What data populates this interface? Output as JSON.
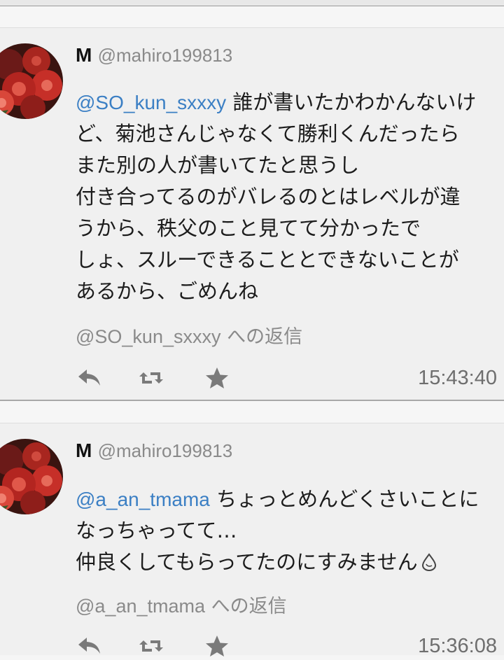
{
  "tweets": [
    {
      "display_name": "M",
      "handle": "@mahiro199813",
      "text_lines": [
        {
          "mention": "@SO_kun_sxxxy",
          "text": " 誰が書いたかわかんないけ"
        },
        {
          "mention": "",
          "text": "ど、菊池さんじゃなくて勝利くんだったら"
        },
        {
          "mention": "",
          "text": "また別の人が書いてたと思うし"
        },
        {
          "mention": "",
          "text": "付き合ってるのがバレるのとはレベルが違"
        },
        {
          "mention": "",
          "text": "うから、秩父のこと見てて分かったで"
        },
        {
          "mention": "",
          "text": "しょ、スルーできることとできないことが"
        },
        {
          "mention": "",
          "text": "あるから、ごめんね"
        }
      ],
      "reply_to_handle": "@SO_kun_sxxxy",
      "reply_to_suffix": " への返信",
      "time": "15:43:40",
      "icons": {
        "reply": "reply-icon",
        "retweet": "retweet-icon",
        "favorite": "star-icon"
      }
    },
    {
      "display_name": "M",
      "handle": "@mahiro199813",
      "text_lines": [
        {
          "mention": "@a_an_tmama",
          "text": " ちょっとめんどくさいことに"
        },
        {
          "mention": "",
          "text": "なっちゃってて…"
        },
        {
          "mention": "",
          "text": "仲良くしてもらってたのにすみません"
        }
      ],
      "reply_to_handle": "@a_an_tmama",
      "reply_to_suffix": " への返信",
      "time": "15:36:08",
      "icons": {
        "reply": "reply-icon",
        "retweet": "retweet-icon",
        "favorite": "star-icon"
      }
    }
  ],
  "colors": {
    "mention": "#3b7fc4",
    "meta": "#8a8a8a",
    "icon": "#7a7a7a",
    "background": "#f0f0f0"
  }
}
